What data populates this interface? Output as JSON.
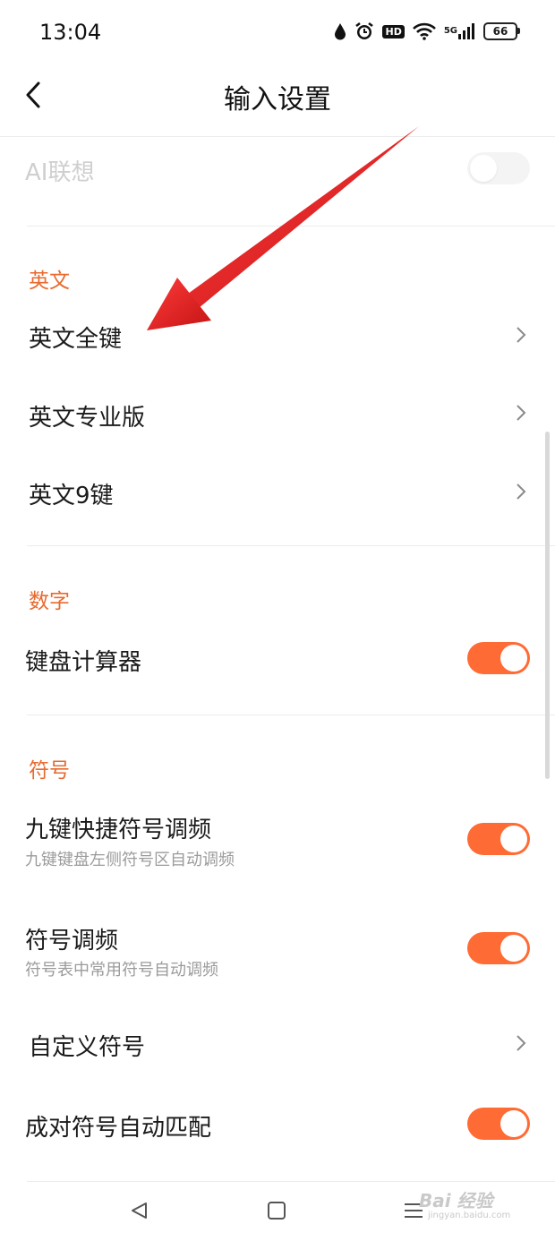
{
  "status": {
    "time": "13:04",
    "network": "5G",
    "battery": "66",
    "hd": "HD"
  },
  "header": {
    "title": "输入设置"
  },
  "rows": {
    "ai": {
      "label": "AI联想",
      "enabled": false
    },
    "english_section": "英文",
    "en_full": "英文全键",
    "en_pro": "英文专业版",
    "en_9": "英文9键",
    "number_section": "数字",
    "calculator": {
      "label": "键盘计算器",
      "on": true
    },
    "symbol_section": "符号",
    "nine_key_symbol": {
      "label": "九键快捷符号调频",
      "sub": "九键键盘左侧符号区自动调频",
      "on": true
    },
    "symbol_freq": {
      "label": "符号调频",
      "sub": "符号表中常用符号自动调频",
      "on": true
    },
    "custom_symbol": "自定义符号",
    "pair_match": {
      "label": "成对符号自动匹配",
      "on": true
    }
  },
  "watermark": {
    "main": "Bai 经验",
    "sub": "jingyan.baidu.com"
  },
  "colors": {
    "accent": "#ff6b35",
    "section": "#e86a2e",
    "arrow": "#e0201e"
  }
}
